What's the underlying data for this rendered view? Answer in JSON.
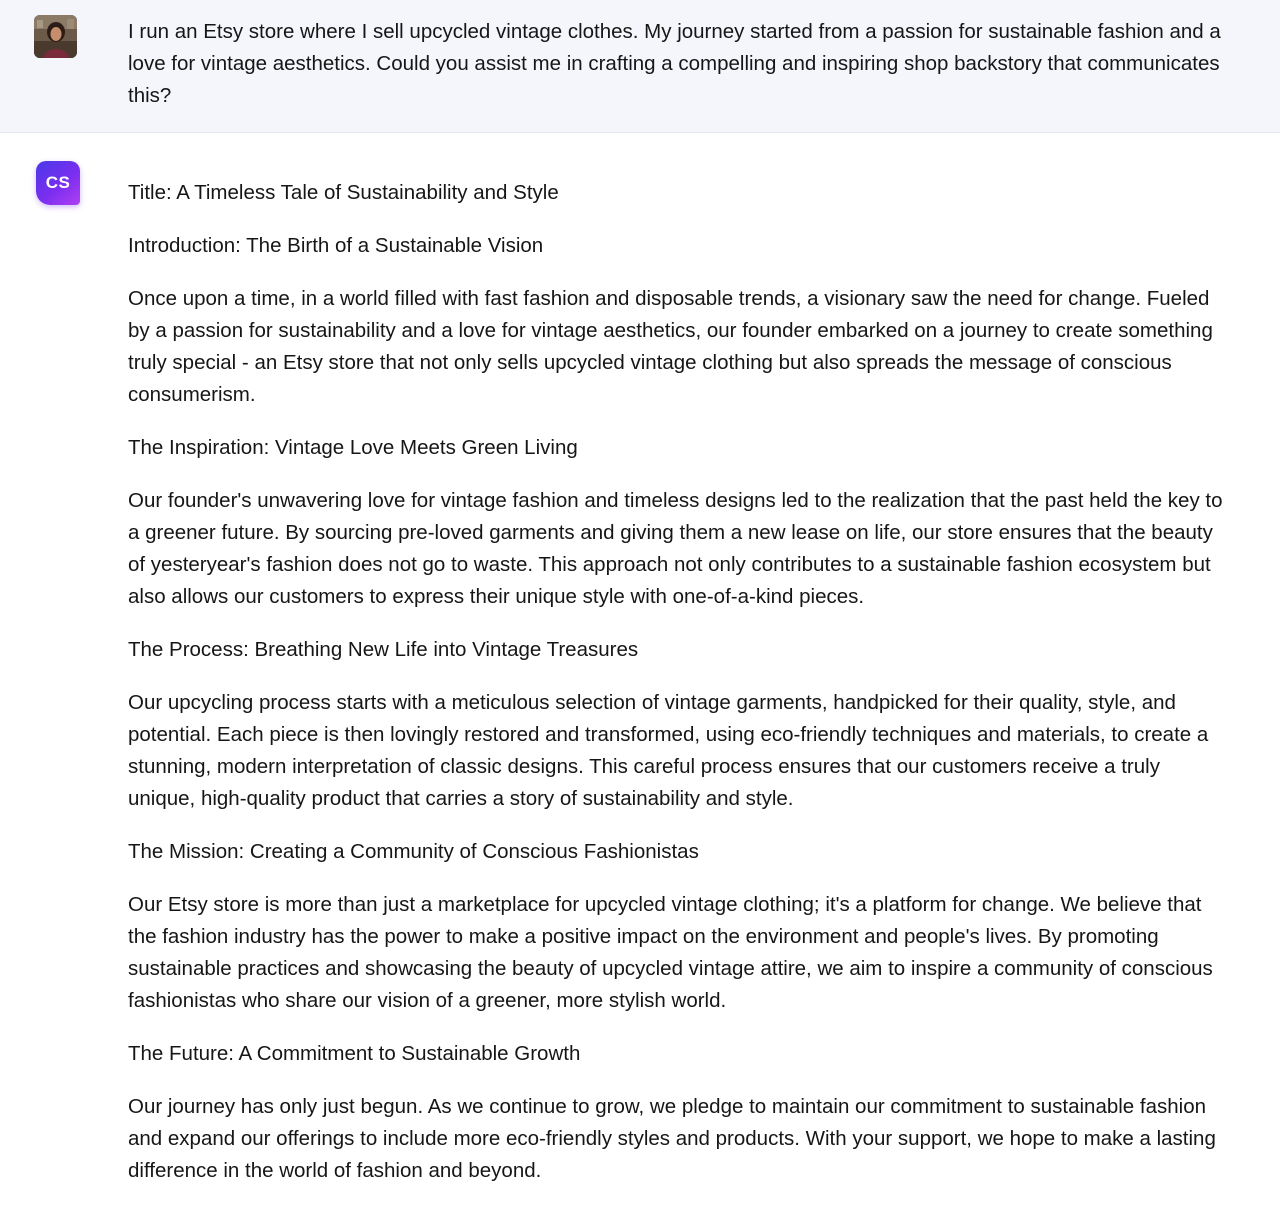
{
  "conversation": {
    "user_message": {
      "avatar": "user-photo-avatar",
      "text": "I run an Etsy store where I sell upcycled vintage clothes. My journey started from a passion for sustainable fashion and a love for vintage aesthetics. Could you assist me in crafting a compelling and inspiring shop backstory that communicates this?"
    },
    "assistant_message": {
      "avatar_label": "CS",
      "accent_colors": [
        "#4a39e6",
        "#7a2ef0",
        "#b13ff2"
      ],
      "paragraphs": [
        "Title: A Timeless Tale of Sustainability and Style",
        "Introduction: The Birth of a Sustainable Vision",
        "Once upon a time, in a world filled with fast fashion and disposable trends, a visionary saw the need for change. Fueled by a passion for sustainability and a love for vintage aesthetics, our founder embarked on a journey to create something truly special - an Etsy store that not only sells upcycled vintage clothing but also spreads the message of conscious consumerism.",
        "The Inspiration: Vintage Love Meets Green Living",
        "Our founder's unwavering love for vintage fashion and timeless designs led to the realization that the past held the key to a greener future. By sourcing pre-loved garments and giving them a new lease on life, our store ensures that the beauty of yesteryear's fashion does not go to waste. This approach not only contributes to a sustainable fashion ecosystem but also allows our customers to express their unique style with one-of-a-kind pieces.",
        "The Process: Breathing New Life into Vintage Treasures",
        "Our upcycling process starts with a meticulous selection of vintage garments, handpicked for their quality, style, and potential. Each piece is then lovingly restored and transformed, using eco-friendly techniques and materials, to create a stunning, modern interpretation of classic designs. This careful process ensures that our customers receive a truly unique, high-quality product that carries a story of sustainability and style.",
        "The Mission: Creating a Community of Conscious Fashionistas",
        "Our Etsy store is more than just a marketplace for upcycled vintage clothing; it's a platform for change. We believe that the fashion industry has the power to make a positive impact on the environment and people's lives. By promoting sustainable practices and showcasing the beauty of upcycled vintage attire, we aim to inspire a community of conscious fashionistas who share our vision of a greener, more stylish world.",
        "The Future: A Commitment to Sustainable Growth",
        "Our journey has only just begun. As we continue to grow, we pledge to maintain our commitment to sustainable fashion and expand our offerings to include more eco-friendly styles and products. With your support, we hope to make a lasting difference in the world of fashion and beyond."
      ]
    }
  }
}
